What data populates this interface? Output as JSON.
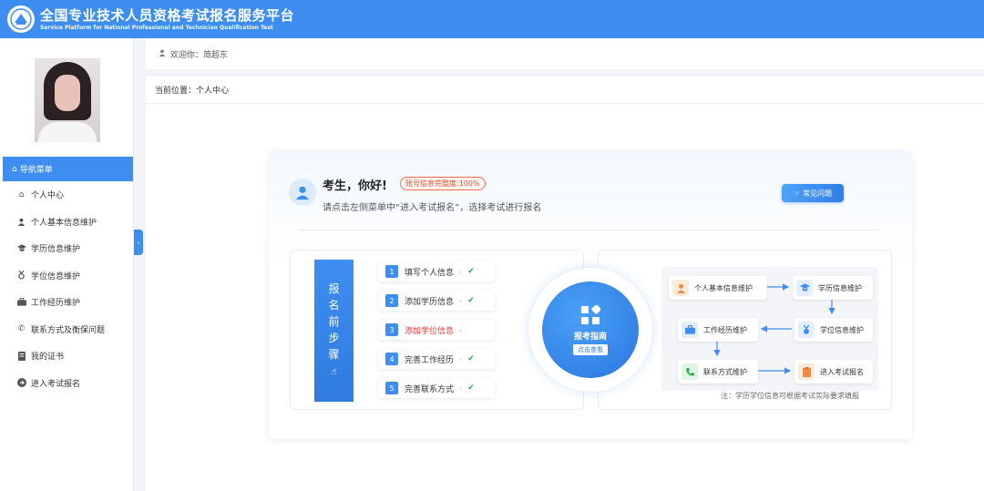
{
  "header": {
    "title": "全国专业技术人员资格考试报名服务平台",
    "subtitle": "Service Platform for National Professional and Technician Qualification Test"
  },
  "welcome": {
    "text": "欢迎你：简超东"
  },
  "breadcrumb": {
    "text": "当前位置：个人中心"
  },
  "sidebar": {
    "nav_title": "导航菜单",
    "items": [
      {
        "label": "个人中心",
        "icon": "home-icon"
      },
      {
        "label": "个人基本信息维护",
        "icon": "user-icon"
      },
      {
        "label": "学历信息维护",
        "icon": "graduation-cap-icon"
      },
      {
        "label": "学位信息维护",
        "icon": "medal-icon"
      },
      {
        "label": "工作经历维护",
        "icon": "briefcase-icon"
      },
      {
        "label": "联系方式及衡保问题",
        "icon": "phone-icon"
      },
      {
        "label": "我的证书",
        "icon": "certificate-icon"
      },
      {
        "label": "进入考试报名",
        "icon": "arrow-circle-icon"
      }
    ]
  },
  "card": {
    "greeting": "考生，你好!",
    "badge": "账号信息完整度:100%",
    "subtitle": "请点击左侧菜单中“进入考试报名”，选择考试进行报名",
    "faq_button": "常见问题",
    "steps_title_chars": [
      "报",
      "名",
      "前",
      "步",
      "骤"
    ],
    "steps": [
      {
        "num": "1",
        "label": "填写个人信息",
        "done": true
      },
      {
        "num": "2",
        "label": "添加学历信息",
        "done": true
      },
      {
        "num": "3",
        "label": "添加学位信息",
        "done": false
      },
      {
        "num": "4",
        "label": "完善工作经历",
        "done": true
      },
      {
        "num": "5",
        "label": "完善联系方式",
        "done": true
      }
    ],
    "guide_title": "报考指南",
    "guide_button": "点击查看",
    "flow_nodes": {
      "basic": "个人基本信息维护",
      "education": "学历信息维护",
      "work": "工作经历维护",
      "degree": "学位信息维护",
      "contact": "联系方式维护",
      "enter": "进入考试报名"
    },
    "note": "注：学历学位信息可根据考试实际要求填报"
  },
  "colors": {
    "primary": "#3d8ef0",
    "success": "#2bb24c",
    "warning": "#e0522f"
  }
}
